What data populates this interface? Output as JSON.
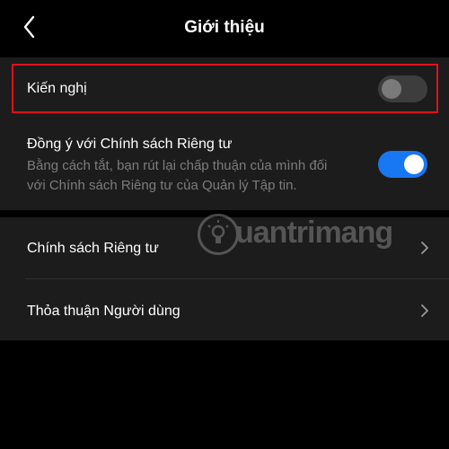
{
  "header": {
    "title": "Giới thiệu",
    "back_icon": "chevron-left-icon"
  },
  "settings": {
    "recommend": {
      "label": "Kiến nghị",
      "enabled": false
    },
    "privacy_consent": {
      "label": "Đồng ý với Chính sách Riêng tư",
      "description_line1": "Bằng cách tắt, bạn rút lại chấp thuận của mình đối",
      "description_line2": "với Chính sách Riêng tư của Quản lý Tập tin.",
      "enabled": true
    }
  },
  "links": [
    {
      "label": "Chính sách Riêng tư",
      "icon": "chevron-right-icon"
    },
    {
      "label": "Thỏa thuận Người dùng",
      "icon": "chevron-right-icon"
    }
  ],
  "watermark": {
    "text": "uantrimang"
  },
  "colors": {
    "background": "#000000",
    "card": "#1c1c1c",
    "accent": "#1877f2",
    "highlight_border": "#e0101c",
    "secondary_text": "#7c7c7c"
  }
}
